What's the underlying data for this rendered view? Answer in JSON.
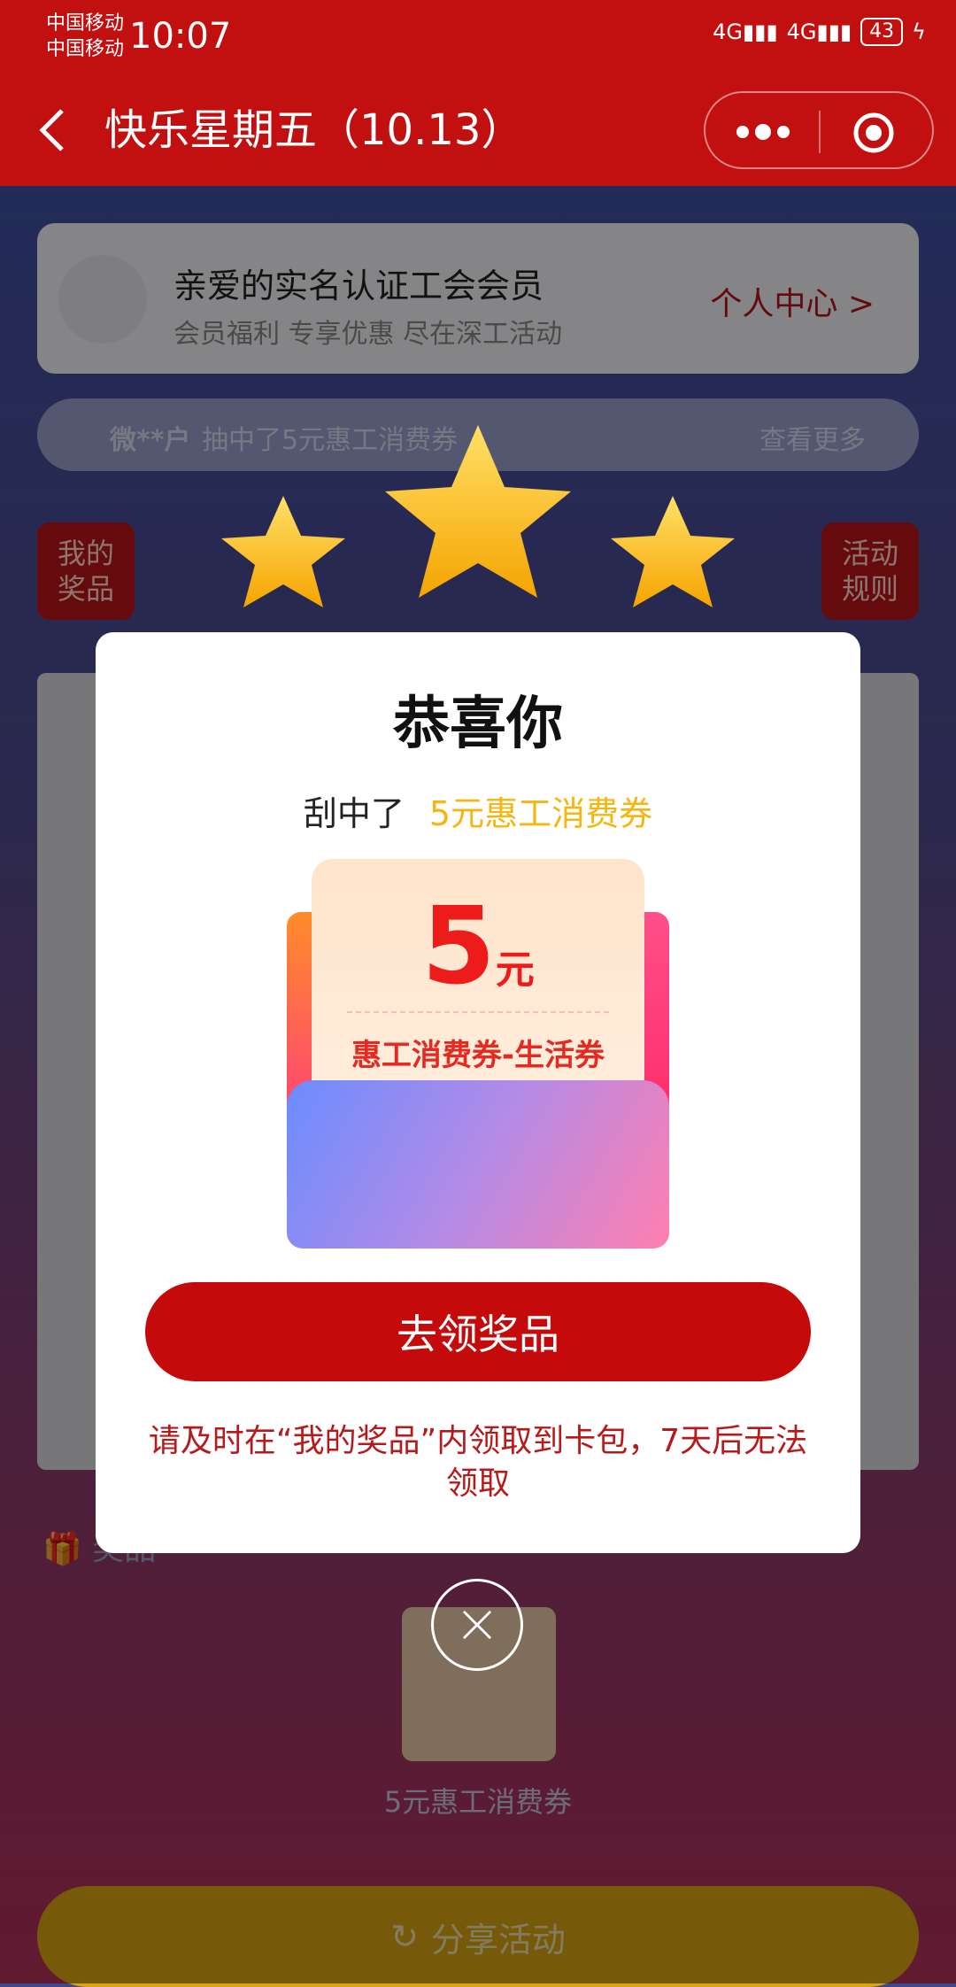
{
  "status_bar": {
    "carrier1": "中国移动",
    "carrier2": "中国移动",
    "time": "10:07",
    "signal1": "4G",
    "signal2": "4G",
    "battery": "43"
  },
  "navbar": {
    "title": "快乐星期五（10.13）"
  },
  "member": {
    "title": "亲爱的实名认证工会会员",
    "subtitle": "会员福利 专享优惠 尽在深工活动",
    "link": "个人中心 >"
  },
  "ticker": {
    "user": "微**户",
    "text": "抽中了5元惠工消费券",
    "more": "查看更多"
  },
  "side_buttons": {
    "my_prizes": "我的\n奖品",
    "rules": "活动\n规则"
  },
  "prizes_section": {
    "title": "奖品",
    "item": "5元惠工消费券"
  },
  "share_button": "分享活动",
  "modal": {
    "title": "恭喜你",
    "won_prefix": "刮中了",
    "won_prize": "5元惠工消费券",
    "coupon_amount": "5",
    "coupon_unit": "元",
    "coupon_label": "惠工消费券-生活券",
    "claim_button": "去领奖品",
    "notice": "请及时在“我的奖品”内领取到卡包，7天后无法领取"
  },
  "colors": {
    "primary_red": "#c20f0f",
    "gold": "#f5b611"
  }
}
